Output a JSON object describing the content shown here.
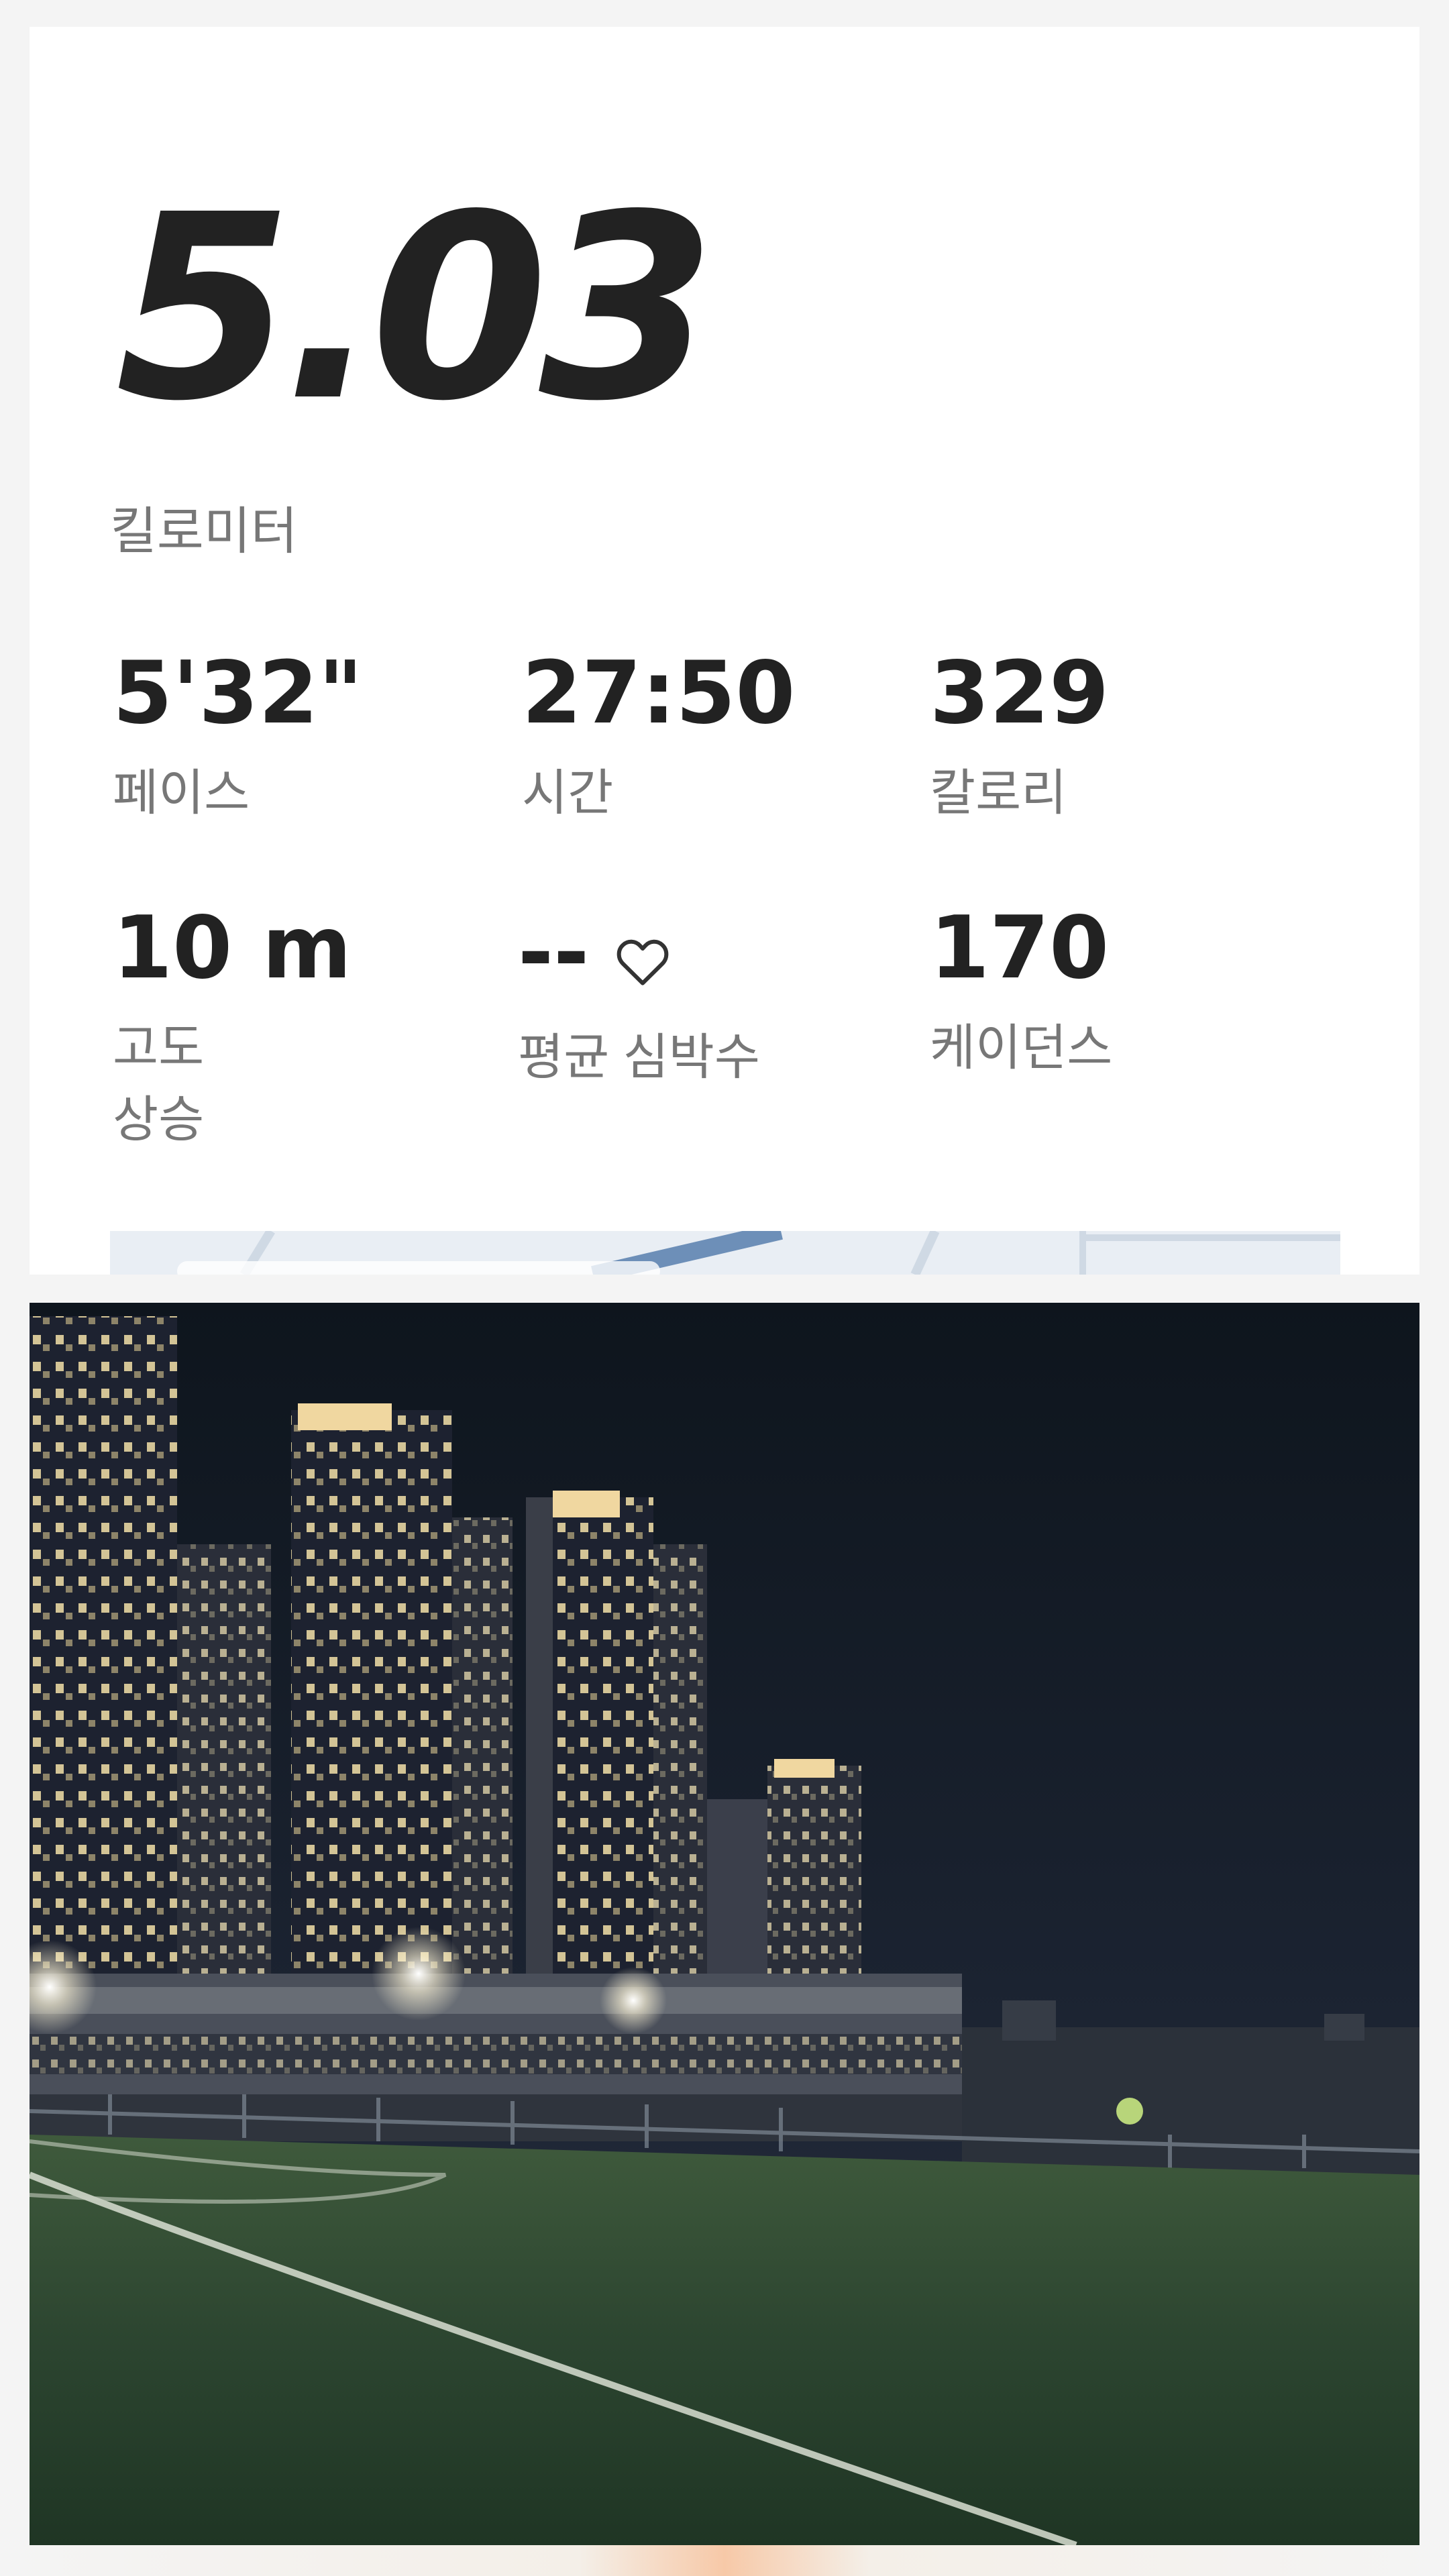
{
  "summary": {
    "distance": "5.03",
    "distance_unit": "킬로미터"
  },
  "stats": [
    {
      "value": "5'32\"",
      "label": "페이스"
    },
    {
      "value": "27:50",
      "label": "시간"
    },
    {
      "value": "329",
      "label": "칼로리"
    },
    {
      "value": "10 m",
      "label": "고도\n상승"
    },
    {
      "value": "--",
      "label": "평균 심박수",
      "icon": "heart-icon"
    },
    {
      "value": "170",
      "label": "케이던스"
    }
  ],
  "colors": {
    "text_primary": "#222222",
    "text_secondary": "#777777",
    "card_background": "#ffffff",
    "page_background": "#f4f4f4"
  }
}
